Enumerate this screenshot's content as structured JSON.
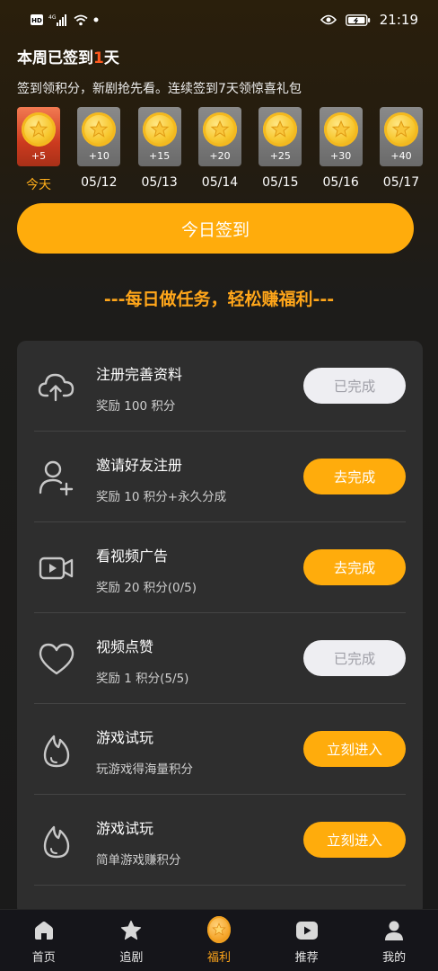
{
  "status_bar": {
    "network_badge": "HD",
    "signal_label": "4G",
    "time": "21:19",
    "icons": [
      "hd-icon",
      "signal-icon",
      "wifi-icon",
      "dot-icon",
      "eye-icon",
      "battery-icon"
    ]
  },
  "header": {
    "week_title_prefix": "本周已签到",
    "week_title_count": "1",
    "week_title_suffix": "天",
    "subtitle": "签到领积分，新剧抢先看。连续签到7天领惊喜礼包"
  },
  "days": [
    {
      "points": "+5",
      "label": "今天",
      "today": true
    },
    {
      "points": "+10",
      "label": "05/12",
      "today": false
    },
    {
      "points": "+15",
      "label": "05/13",
      "today": false
    },
    {
      "points": "+20",
      "label": "05/14",
      "today": false
    },
    {
      "points": "+25",
      "label": "05/15",
      "today": false
    },
    {
      "points": "+30",
      "label": "05/16",
      "today": false
    },
    {
      "points": "+40",
      "label": "05/17",
      "today": false
    }
  ],
  "checkin_button": "今日签到",
  "section_title": "---每日做任务，轻松赚福利---",
  "tasks": [
    {
      "icon": "cloud-upload-icon",
      "name": "注册完善资料",
      "reward": "奖励 100 积分",
      "button": "已完成",
      "state": "done"
    },
    {
      "icon": "add-user-icon",
      "name": "邀请好友注册",
      "reward": "奖励 10 积分+永久分成",
      "button": "去完成",
      "state": "active"
    },
    {
      "icon": "video-icon",
      "name": "看视频广告",
      "reward": "奖励 20 积分(0/5)",
      "button": "去完成",
      "state": "active"
    },
    {
      "icon": "heart-icon",
      "name": "视频点赞",
      "reward": "奖励 1 积分(5/5)",
      "button": "已完成",
      "state": "done"
    },
    {
      "icon": "flame-icon",
      "name": "游戏试玩",
      "reward": "玩游戏得海量积分",
      "button": "立刻进入",
      "state": "active"
    },
    {
      "icon": "flame-icon",
      "name": "游戏试玩",
      "reward": "简单游戏赚积分",
      "button": "立刻进入",
      "state": "active"
    }
  ],
  "bottom_nav": [
    {
      "icon": "home-icon",
      "label": "首页",
      "active": false
    },
    {
      "icon": "star-icon",
      "label": "追剧",
      "active": false
    },
    {
      "icon": "coin-icon",
      "label": "福利",
      "active": true
    },
    {
      "icon": "play-icon",
      "label": "推荐",
      "active": false
    },
    {
      "icon": "user-icon",
      "label": "我的",
      "active": false
    }
  ],
  "colors": {
    "accent": "#ffac0c",
    "title_accent": "#ffa61a",
    "highlight": "#ff5a1f",
    "done_button_bg": "#eeeef2",
    "card_bg": "#2e2e2e"
  }
}
